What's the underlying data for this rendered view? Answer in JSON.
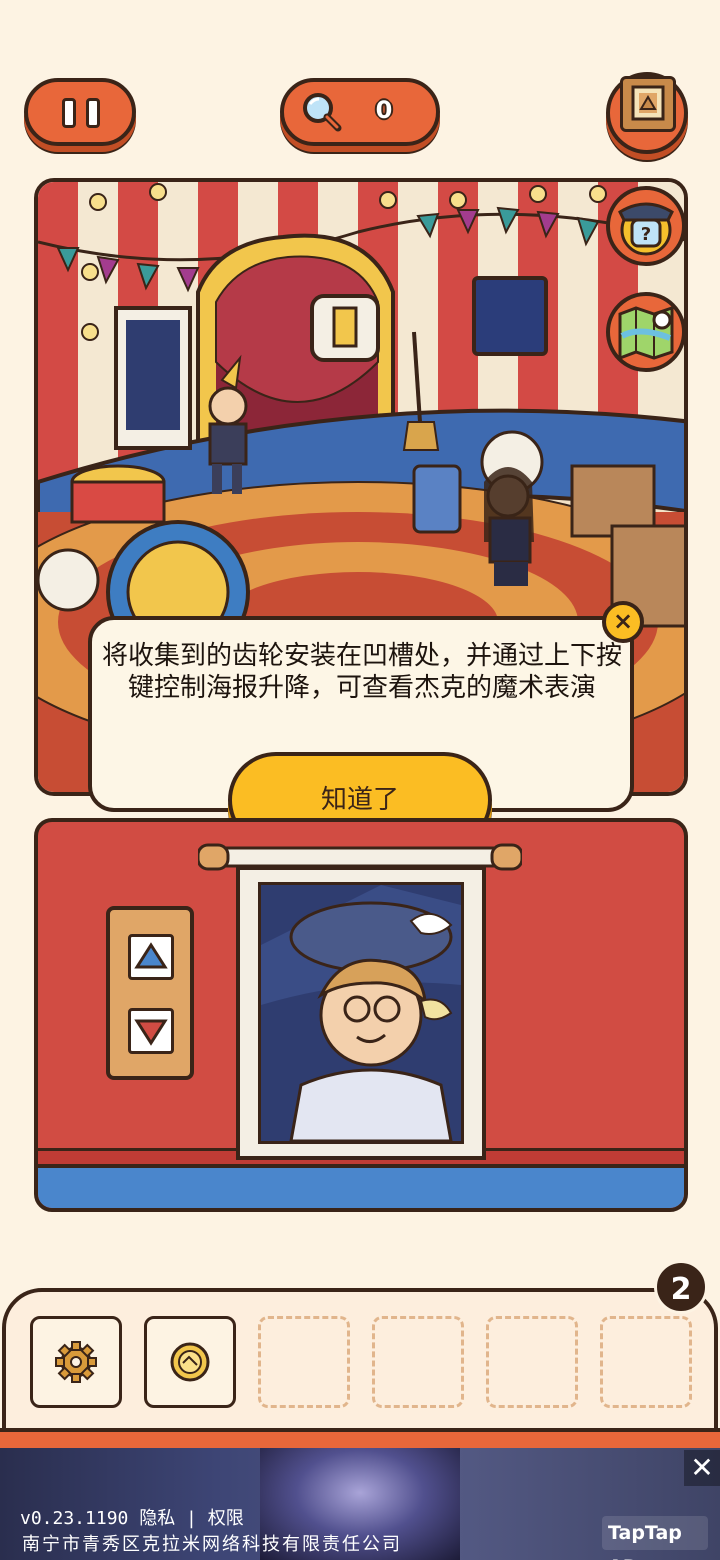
{
  "hud": {
    "hint_count": "0"
  },
  "dialog": {
    "tip_text": "将收集到的齿轮安装在凹槽处，并通过上下按键控制海报升降，可查看杰克的魔术表演",
    "confirm_label": "知道了",
    "close_symbol": "×"
  },
  "inventory": {
    "count": "2",
    "slots": [
      "gear",
      "golden-coin",
      "",
      "",
      "",
      ""
    ]
  },
  "ad": {
    "version_text": "v0.23.1190  隐私 | 权限",
    "company_text": "南宁市青秀区克拉米网络科技有限责任公司",
    "brand_label": "TapTap AD",
    "close_symbol": "✕"
  },
  "colors": {
    "accent_orange": "#e8673a",
    "button_yellow": "#fbbd23",
    "outline": "#3a2418",
    "background": "#fdf3e3",
    "panel_red": "#d14c43",
    "floor_blue": "#4a86cc"
  },
  "icons": {
    "pause": "pause-icon",
    "hint": "magnifier-icon",
    "menu": "crate-picture-icon",
    "helper": "detective-question-icon",
    "map": "map-pin-icon",
    "up": "triangle-up-icon",
    "down": "triangle-down-icon",
    "gear": "gear-icon",
    "coin": "coin-icon"
  }
}
